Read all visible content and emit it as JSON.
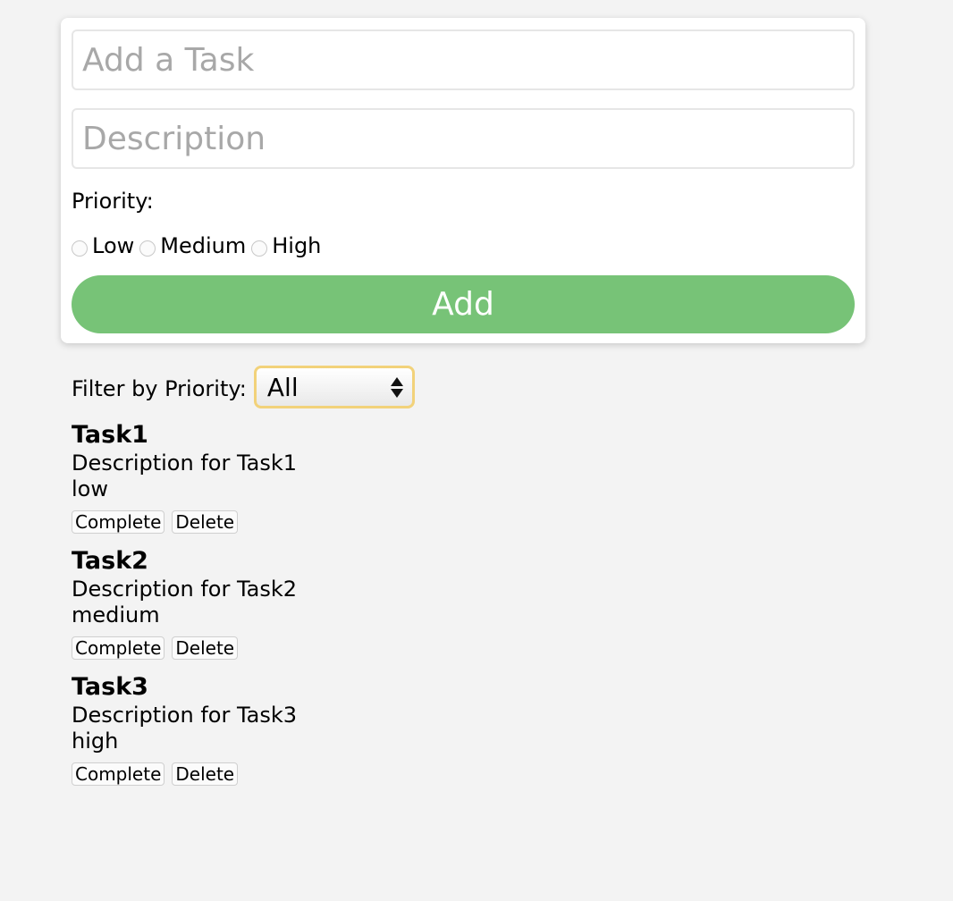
{
  "form": {
    "task_placeholder": "Add a Task",
    "task_value": "",
    "description_placeholder": "Description",
    "description_value": "",
    "priority_label": "Priority:",
    "priority_options": [
      {
        "label": "Low",
        "selected": false
      },
      {
        "label": "Medium",
        "selected": false
      },
      {
        "label": "High",
        "selected": false
      }
    ],
    "add_label": "Add"
  },
  "filter": {
    "label": "Filter by Priority:",
    "selected": "All"
  },
  "tasks": [
    {
      "title": "Task1",
      "description": "Description for Task1",
      "priority": "low",
      "complete_label": "Complete",
      "delete_label": "Delete"
    },
    {
      "title": "Task2",
      "description": "Description for Task2",
      "priority": "medium",
      "complete_label": "Complete",
      "delete_label": "Delete"
    },
    {
      "title": "Task3",
      "description": "Description for Task3",
      "priority": "high",
      "complete_label": "Complete",
      "delete_label": "Delete"
    }
  ],
  "colors": {
    "page_background": "#f3f3f3",
    "add_button": "#77c377",
    "filter_focus_border": "#f2d27a"
  }
}
